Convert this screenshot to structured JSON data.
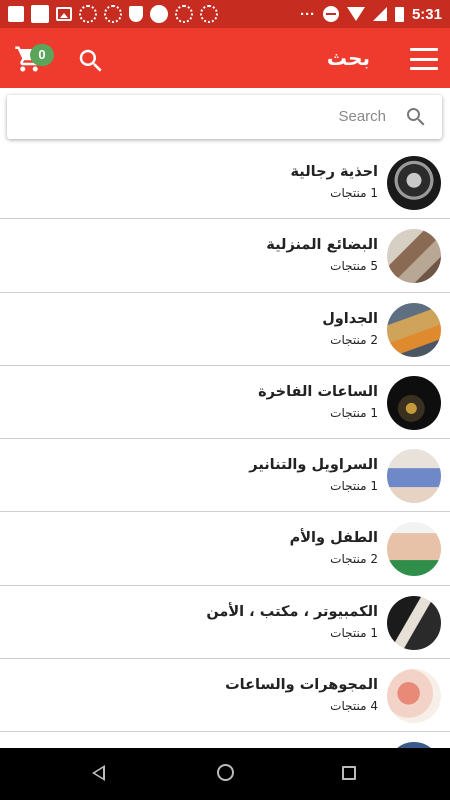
{
  "status_bar": {
    "time": "5:31",
    "icons": [
      "square-icon",
      "square-icon",
      "image-icon",
      "dotted-circle-icon",
      "dotted-circle-icon",
      "shield-icon",
      "circle-icon",
      "dotted-circle-icon",
      "dotted-circle-icon",
      "more-dots-icon",
      "dnd-icon",
      "wifi-icon",
      "signal-icon",
      "battery-icon"
    ],
    "more": "···"
  },
  "app_bar": {
    "title": "بحث",
    "cart_count": "0",
    "icons": [
      "cart-icon",
      "search-icon",
      "menu-icon"
    ],
    "color": "#ef3b2d"
  },
  "search": {
    "placeholder": "Search"
  },
  "categories": [
    {
      "name": "احذية رجالية",
      "count": "1 منتجات"
    },
    {
      "name": "البضائع المنزلية",
      "count": "5 منتجات"
    },
    {
      "name": "الجداول",
      "count": "2 منتجات"
    },
    {
      "name": "الساعات الفاخرة",
      "count": "1 منتجات"
    },
    {
      "name": "السراويل والتنانير",
      "count": "1 منتجات"
    },
    {
      "name": "الطفل والأم",
      "count": "2 منتجات"
    },
    {
      "name": "الكمبيوتر ، مكتب ، الأمن",
      "count": "1 منتجات"
    },
    {
      "name": "المجوهرات والساعات",
      "count": "4 منتجات"
    }
  ],
  "nav_bar": {
    "icons": [
      "back-icon",
      "home-icon",
      "recents-icon"
    ]
  }
}
